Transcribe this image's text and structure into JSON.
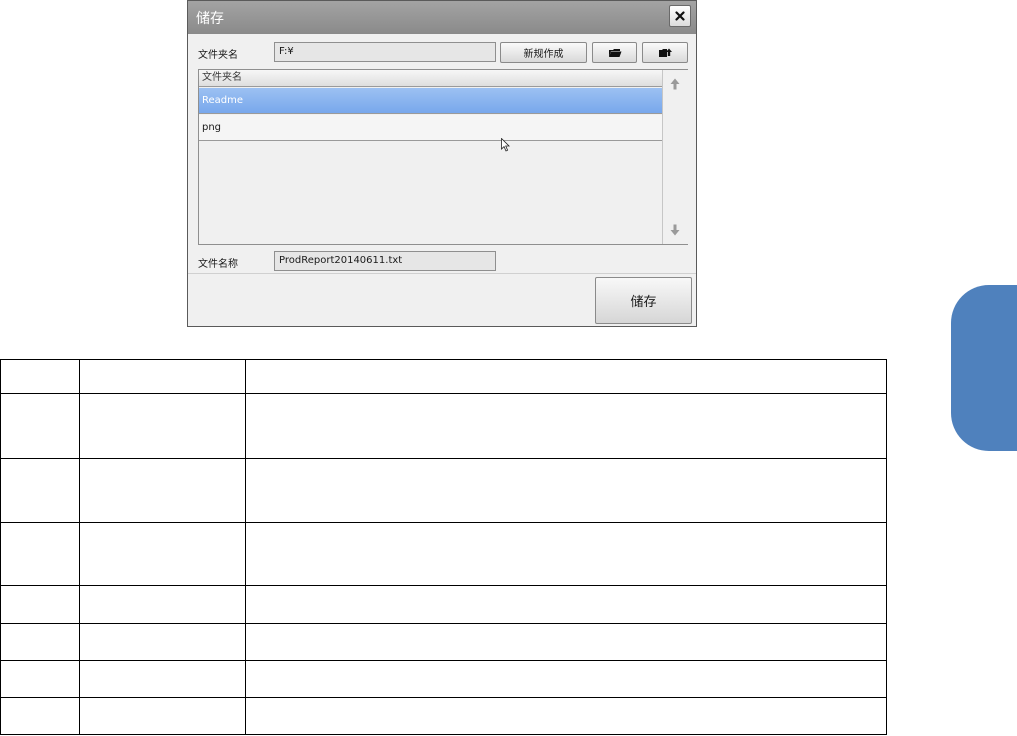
{
  "dialog": {
    "title": "储存",
    "close_icon": "close-icon",
    "folder_label": "文件夹名",
    "folder_path": "F:¥",
    "new_folder_button": "新规作成",
    "open_folder_icon": "folder-open-icon",
    "folder_up_icon": "folder-up-icon",
    "list_header": "文件夹名",
    "list_items": [
      {
        "label": "Readme",
        "selected": true
      },
      {
        "label": "png",
        "selected": false
      }
    ],
    "scroll_up_icon": "arrow-up-icon",
    "scroll_down_icon": "arrow-down-icon",
    "filename_label": "文件名称",
    "filename_value": "ProdReport20140611.txt",
    "save_button": "储存"
  },
  "colors": {
    "selected_row": "#78a8ec",
    "side_tab": "#4f81bd",
    "titlebar": "#8a8a8a"
  },
  "table": {
    "rows": 8,
    "columns": 3
  }
}
